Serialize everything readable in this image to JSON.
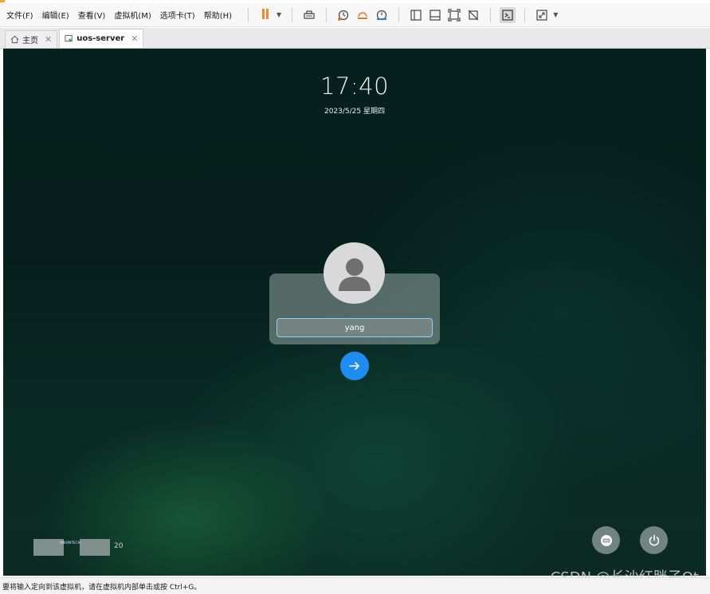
{
  "menu": {
    "items": [
      "文件(F)",
      "编辑(E)",
      "查看(V)",
      "虚拟机(M)",
      "选项卡(T)",
      "帮助(H)"
    ]
  },
  "toolbar": {
    "icons": [
      "pause-icon",
      "send-ctrl-alt-del-icon",
      "snapshot-icon",
      "revert-snapshot-icon",
      "snapshot-manager-icon",
      "show-library-icon",
      "thumbnail-bar-icon",
      "fit-guest-icon",
      "autofit-icon",
      "console-view-icon",
      "fullscreen-icon"
    ]
  },
  "tabs": [
    {
      "label": "主页",
      "icon": "home-icon"
    },
    {
      "label": "uos-server",
      "icon": "vm-icon",
      "active": true
    }
  ],
  "vm": {
    "time": "17:40",
    "date": "2023/5/25 星期四",
    "username": "yang",
    "logo_number": "20",
    "logo_text": "UNIONTECH"
  },
  "status": {
    "message": "要将输入定向到该虚拟机，请在虚拟机内部单击或按 Ctrl+G。",
    "watermark": "CSDN @长沙红胖子Qt"
  },
  "colors": {
    "accent_blue": "#1e8cf0",
    "pause_orange": "#f08b25",
    "bg_dark_green": "#05201d"
  }
}
